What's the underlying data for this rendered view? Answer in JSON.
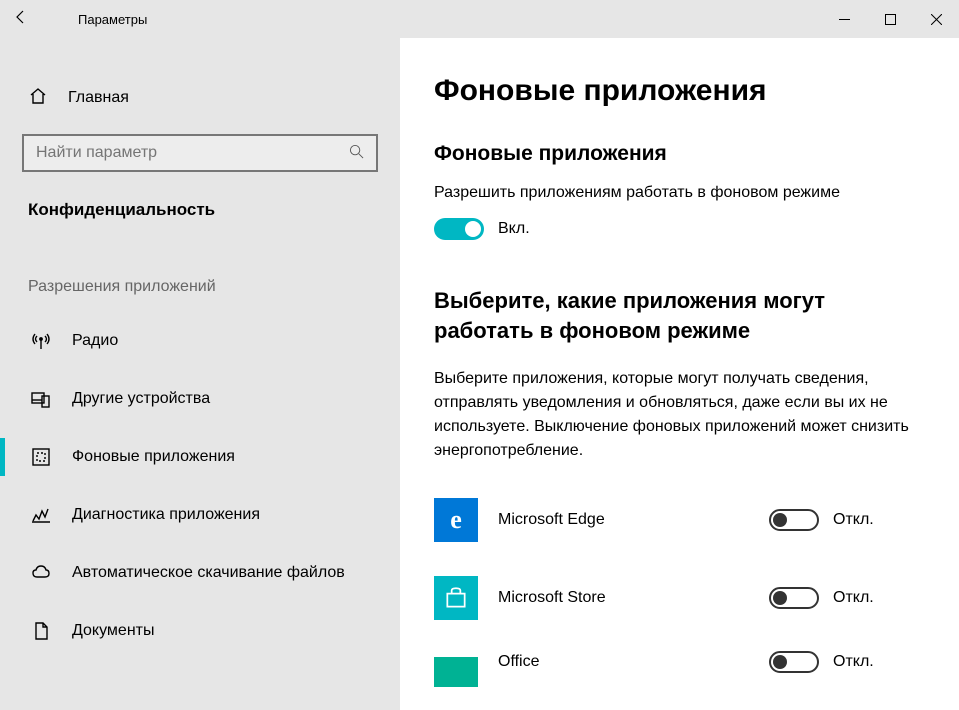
{
  "window": {
    "title": "Параметры"
  },
  "sidebar": {
    "home": "Главная",
    "search_placeholder": "Найти параметр",
    "category": "Конфиденциальность",
    "group_header": "Разрешения приложений",
    "items": [
      {
        "label": "Радио",
        "icon": "radio"
      },
      {
        "label": "Другие устройства",
        "icon": "devices"
      },
      {
        "label": "Фоновые приложения",
        "icon": "background",
        "selected": true
      },
      {
        "label": "Диагностика приложения",
        "icon": "diagnostics"
      },
      {
        "label": "Автоматическое скачивание файлов",
        "icon": "cloud"
      },
      {
        "label": "Документы",
        "icon": "document"
      }
    ]
  },
  "main": {
    "page_title": "Фоновые приложения",
    "section1_title": "Фоновые приложения",
    "section1_desc": "Разрешить приложениям работать в фоновом режиме",
    "main_toggle_label": "Вкл.",
    "section2_title": "Выберите, какие приложения могут работать в фоновом режиме",
    "section2_body": "Выберите приложения, которые могут получать сведения, отправлять уведомления и обновляться, даже если вы их не используете. Выключение фоновых приложений может снизить энергопотребление.",
    "apps": [
      {
        "name": "Microsoft Edge",
        "state_label": "Откл.",
        "color": "#0078d7",
        "glyph": "e"
      },
      {
        "name": "Microsoft Store",
        "state_label": "Откл.",
        "color": "#00b7c3",
        "glyph": "store"
      },
      {
        "name": "Office",
        "state_label": "Откл.",
        "color": "#00b294",
        "glyph": ""
      }
    ]
  }
}
